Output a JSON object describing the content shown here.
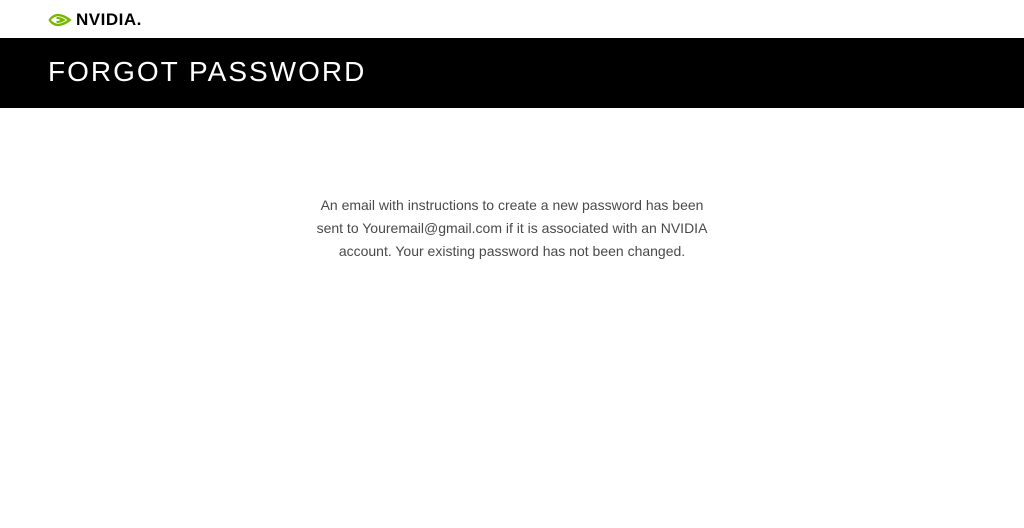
{
  "brand": {
    "name": "NVIDIA.",
    "accentColor": "#76b900"
  },
  "header": {
    "title": "FORGOT PASSWORD"
  },
  "main": {
    "message": "An email with instructions to create a new password has been sent to Youremail@gmail.com if it is associated with an NVIDIA account. Your existing password has not been changed."
  }
}
